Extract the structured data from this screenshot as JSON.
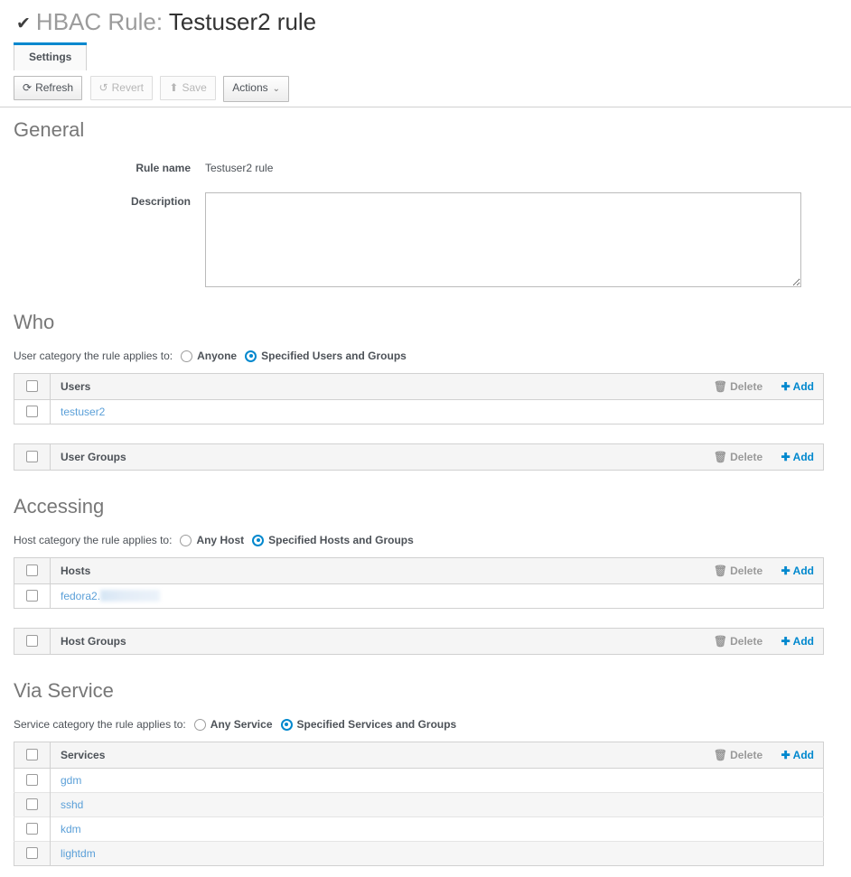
{
  "header": {
    "check_icon": "✔",
    "prefix": "HBAC Rule:",
    "rule_name": "Testuser2 rule"
  },
  "tabs": [
    {
      "label": "Settings",
      "active": true
    }
  ],
  "toolbar": {
    "refresh_label": "Refresh",
    "refresh_icon": "⟳",
    "revert_label": "Revert",
    "revert_icon": "↺",
    "save_label": "Save",
    "save_icon": "⬆",
    "actions_label": "Actions",
    "actions_caret": "⌄"
  },
  "colors": {
    "accent": "#0088ce",
    "link": "#5a9fd8",
    "muted": "#9a9a9a",
    "heading": "#777777"
  },
  "sections": {
    "general": {
      "title": "General",
      "rule_name_label": "Rule name",
      "rule_name_value": "Testuser2 rule",
      "description_label": "Description",
      "description_value": "",
      "description_placeholder": ""
    },
    "who": {
      "title": "Who",
      "category_label": "User category the rule applies to:",
      "options": [
        {
          "label": "Anyone",
          "selected": false
        },
        {
          "label": "Specified Users and Groups",
          "selected": true
        }
      ],
      "users_table": {
        "column": "Users",
        "delete_label": "Delete",
        "add_label": "Add",
        "rows": [
          {
            "name": "testuser2",
            "redacted": false
          }
        ]
      },
      "user_groups_table": {
        "column": "User Groups",
        "delete_label": "Delete",
        "add_label": "Add",
        "rows": []
      }
    },
    "accessing": {
      "title": "Accessing",
      "category_label": "Host category the rule applies to:",
      "options": [
        {
          "label": "Any Host",
          "selected": false
        },
        {
          "label": "Specified Hosts and Groups",
          "selected": true
        }
      ],
      "hosts_table": {
        "column": "Hosts",
        "delete_label": "Delete",
        "add_label": "Add",
        "rows": [
          {
            "name": "fedora2.",
            "redacted": true
          }
        ]
      },
      "host_groups_table": {
        "column": "Host Groups",
        "delete_label": "Delete",
        "add_label": "Add",
        "rows": []
      }
    },
    "via_service": {
      "title": "Via Service",
      "category_label": "Service category the rule applies to:",
      "options": [
        {
          "label": "Any Service",
          "selected": false
        },
        {
          "label": "Specified Services and Groups",
          "selected": true
        }
      ],
      "services_table": {
        "column": "Services",
        "delete_label": "Delete",
        "add_label": "Add",
        "rows": [
          {
            "name": "gdm",
            "redacted": false
          },
          {
            "name": "sshd",
            "redacted": false
          },
          {
            "name": "kdm",
            "redacted": false
          },
          {
            "name": "lightdm",
            "redacted": false
          }
        ]
      }
    }
  },
  "icons": {
    "trash": "🗑",
    "plus": "✚"
  }
}
